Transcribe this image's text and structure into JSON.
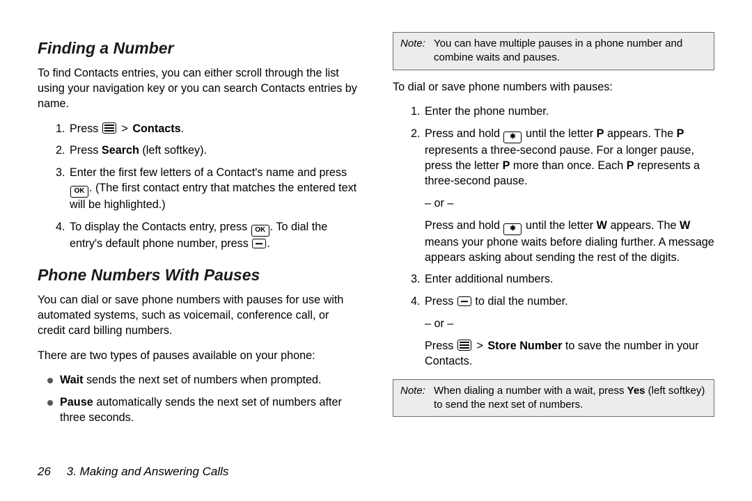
{
  "left": {
    "h1": "Finding a Number",
    "p1": "To find Contacts entries, you can either scroll through the list using your navigation key or you can search Contacts entries by name.",
    "steps": {
      "s1_a": "Press ",
      "s1_b": "Contacts",
      "s1_c": ".",
      "s2_a": "Press ",
      "s2_b": "Search",
      "s2_c": " (left softkey).",
      "s3_a": "Enter the first few letters of a Contact's name and press ",
      "s3_b": ". (The first contact entry that matches the entered text will be highlighted.)",
      "s4_a": "To display the Contacts entry, press ",
      "s4_b": ". To dial the entry's default phone number, press ",
      "s4_c": "."
    },
    "h2": "Phone Numbers With Pauses",
    "p2": "You can dial or save phone numbers with pauses for use with automated systems, such as voicemail, conference call, or credit card billing numbers.",
    "p3": "There are two types of pauses available on your phone:",
    "b1_a": "Wait",
    "b1_b": " sends the next set of numbers when prompted.",
    "b2_a": "Pause",
    "b2_b": " automatically sends the next set of numbers after three seconds."
  },
  "right": {
    "note1_label": "Note:",
    "note1_text": "You can have multiple pauses in a phone number and combine waits and pauses.",
    "intro": "To dial or save phone numbers with pauses:",
    "steps": {
      "s1": "Enter the phone number.",
      "s2_a": "Press and hold ",
      "s2_b": " until the letter ",
      "s2_P": "P",
      "s2_c": " appears. The ",
      "s2_d": " represents a three-second pause. For a longer pause, press the letter ",
      "s2_e": " more than once. Each ",
      "s2_f": " represents a three-second pause.",
      "or": "– or –",
      "s2g_a": "Press and hold ",
      "s2g_b": " until the letter ",
      "s2g_W": "W",
      "s2g_c": " appears. The ",
      "s2g_d": " means your phone waits before dialing further. A message appears asking about sending the rest of the digits.",
      "s3": "Enter additional numbers.",
      "s4_a": "Press ",
      "s4_b": " to dial the number.",
      "s4_or": "– or –",
      "s4c_a": "Press ",
      "s4c_sn": "Store Number",
      "s4c_b": " to save the number in your Contacts."
    },
    "note2_label": "Note:",
    "note2_a": "When dialing a number with a wait, press ",
    "note2_yes": "Yes",
    "note2_b": " (left softkey) to send the next set of numbers."
  },
  "footer": {
    "page": "26",
    "chapter": "3. Making and Answering Calls"
  },
  "glyph": {
    "gt": ">",
    "ok": "OK",
    "star": "✱"
  }
}
